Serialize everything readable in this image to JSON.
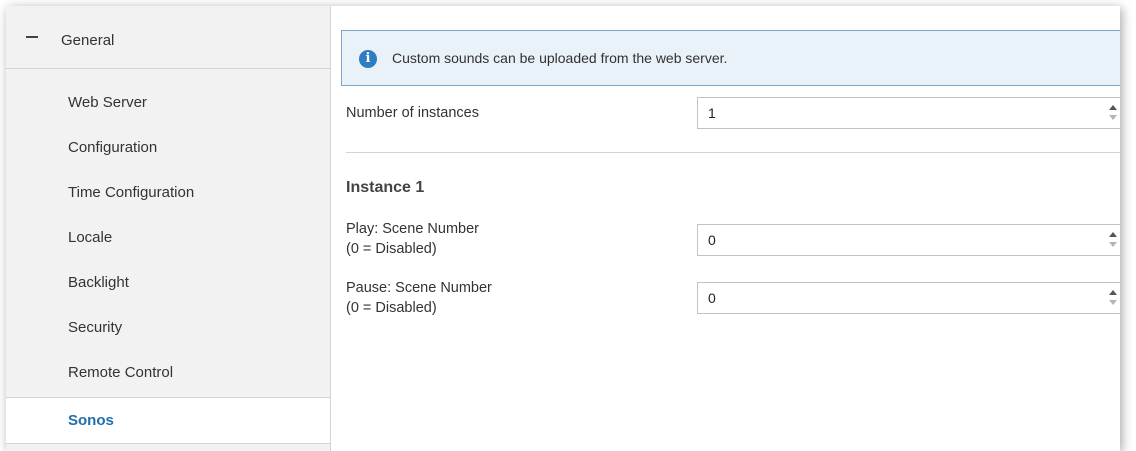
{
  "sidebar": {
    "group_label": "General",
    "items": [
      {
        "label": "Web Server"
      },
      {
        "label": "Configuration"
      },
      {
        "label": "Time Configuration"
      },
      {
        "label": "Locale"
      },
      {
        "label": "Backlight"
      },
      {
        "label": "Security"
      },
      {
        "label": "Remote Control"
      },
      {
        "label": "Sonos",
        "active": true
      }
    ]
  },
  "info": {
    "icon": "info-icon",
    "text": "Custom sounds can be uploaded from the web server."
  },
  "fields": {
    "instances": {
      "label": "Number of instances",
      "value": "1"
    },
    "section_title": "Instance 1",
    "play": {
      "label_line1": "Play: Scene Number",
      "label_line2": "(0 = Disabled)",
      "value": "0"
    },
    "pause": {
      "label_line1": "Pause: Scene Number",
      "label_line2": "(0 = Disabled)",
      "value": "0"
    }
  },
  "colors": {
    "accent": "#1f6fae",
    "info_background": "#e9f1f9",
    "info_border": "#7ea6cc",
    "sidebar_background": "#f2f2f2"
  }
}
